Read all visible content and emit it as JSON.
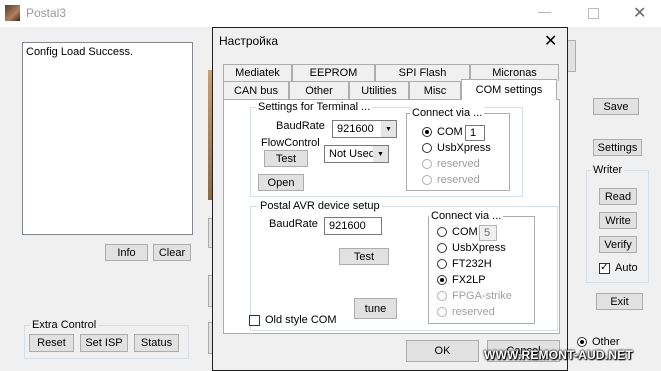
{
  "main_window": {
    "title": "Postal3",
    "log_text": "Config Load Success.",
    "info_button": "Info",
    "clear_button": "Clear",
    "save_button": "Save",
    "settings_button": "Settings",
    "writer_group": "Writer",
    "read_button": "Read",
    "write_button": "Write",
    "verify_button": "Verify",
    "auto_label": "Auto",
    "exit_button": "Exit",
    "extra_control_group": "Extra Control",
    "reset_button": "Reset",
    "set_isp_button": "Set ISP",
    "status_button": "Status",
    "other_label": "Other"
  },
  "dialog": {
    "title": "Настройка",
    "tabs_row1": [
      "Mediatek",
      "EEPROM",
      "SPI Flash",
      "Micronas"
    ],
    "tabs_row2": [
      "CAN bus",
      "Other",
      "Utilities",
      "Misc",
      "COM settings"
    ],
    "terminal": {
      "group_title": "Settings for Terminal  ...",
      "baudrate_label": "BaudRate",
      "baudrate_value": "921600",
      "flowcontrol_label": "FlowControl",
      "flowcontrol_value": "Not Used",
      "test_button": "Test",
      "open_button": "Open",
      "connect_title": "Connect via ...",
      "com_label": "COM",
      "com_port": "1",
      "usbxpress_label": "UsbXpress",
      "reserved1_label": "reserved",
      "reserved2_label": "reserved"
    },
    "avr": {
      "group_title": "Postal AVR device setup",
      "baudrate_label": "BaudRate",
      "baudrate_value": "921600",
      "test_button": "Test",
      "tune_button": "tune",
      "old_style_label": "Old style COM",
      "connect_title": "Connect via ...",
      "com_label": "COM",
      "com_port": "5",
      "usbxpress_label": "UsbXpress",
      "ft232h_label": "FT232H",
      "fx2lp_label": "FX2LP",
      "fpga_label": "FPGA-strike",
      "reserved_label": "reserved"
    },
    "ok_button": "OK",
    "cancel_button": "Cancel"
  },
  "watermark": "WWW.REMONT-AUD.NET"
}
